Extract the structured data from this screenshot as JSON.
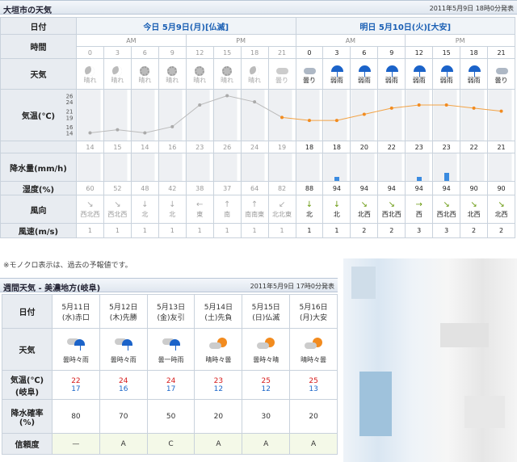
{
  "header1": {
    "title": "大垣市の天気",
    "published": "2011年5月9日 18時0分発表"
  },
  "labels": {
    "date": "日付",
    "time": "時間",
    "weather": "天気",
    "temp": "気温(℃)",
    "precip": "降水量(mm/h)",
    "humidity": "湿度(%)",
    "wind_dir": "風向",
    "wind_speed": "風速(m/s)"
  },
  "days": [
    "今日 5月9日(月)[仏滅]",
    "明日 5月10日(火)[大安]"
  ],
  "ampm": [
    "AM",
    "PM",
    "AM",
    "PM"
  ],
  "hours": [
    "0",
    "3",
    "6",
    "9",
    "12",
    "15",
    "18",
    "21",
    "0",
    "3",
    "6",
    "9",
    "12",
    "15",
    "18",
    "21"
  ],
  "weather": [
    "晴れ",
    "晴れ",
    "晴れ",
    "晴れ",
    "晴れ",
    "晴れ",
    "晴れ",
    "曇り",
    "曇り",
    "弱雨",
    "弱雨",
    "弱雨",
    "弱雨",
    "弱雨",
    "弱雨",
    "曇り"
  ],
  "weather_icons": [
    "moon",
    "moon",
    "sun",
    "sun",
    "sun",
    "sun",
    "moon",
    "cloud",
    "cloud",
    "umbrella",
    "umbrella",
    "umbrella",
    "umbrella",
    "umbrella",
    "umbrella",
    "cloud"
  ],
  "y_ticks": [
    "26",
    "24",
    "21",
    "19",
    "16",
    "14"
  ],
  "temps": [
    "14",
    "15",
    "14",
    "16",
    "23",
    "26",
    "24",
    "19",
    "18",
    "18",
    "20",
    "22",
    "23",
    "23",
    "22",
    "21"
  ],
  "precip": [
    "0",
    "0",
    "0",
    "0",
    "0",
    "0",
    "0",
    "0",
    "0",
    "1",
    "0",
    "0",
    "1",
    "2",
    "0",
    "0"
  ],
  "humidity": [
    "60",
    "52",
    "48",
    "42",
    "38",
    "37",
    "64",
    "82",
    "88",
    "94",
    "94",
    "94",
    "94",
    "94",
    "90",
    "90"
  ],
  "wind_dir": [
    "西北西",
    "西北西",
    "北",
    "北",
    "東",
    "南",
    "南南東",
    "北北東",
    "北",
    "北",
    "北西",
    "西北西",
    "西",
    "西北西",
    "北西",
    "北西"
  ],
  "wind_arrows": [
    "↘",
    "↘",
    "↓",
    "↓",
    "←",
    "↑",
    "↑",
    "↙",
    "↓",
    "↓",
    "↘",
    "↘",
    "→",
    "↘",
    "↘",
    "↘"
  ],
  "wind_speed": [
    "1",
    "1",
    "1",
    "1",
    "1",
    "1",
    "1",
    "1",
    "1",
    "1",
    "2",
    "2",
    "3",
    "3",
    "2",
    "2"
  ],
  "note": "※モノクロ表示は、過去の予報値です。",
  "header2": {
    "title": "週間天気 - 美濃地方(岐阜)",
    "published": "2011年5月9日 17時0分発表"
  },
  "week_labels": {
    "date": "日付",
    "weather": "天気",
    "temp1": "気温(℃)",
    "temp2": "(岐阜)",
    "rain1": "降水確率",
    "rain2": "(%)",
    "rel": "信頼度"
  },
  "week": [
    {
      "date": "5月11日",
      "wd": "(水)",
      "rk": "赤口",
      "wx": "曇時々雨",
      "hi": "22",
      "lo": "17",
      "rain": "80",
      "rel": "—"
    },
    {
      "date": "5月12日",
      "wd": "(木)",
      "rk": "先勝",
      "wx": "曇時々雨",
      "hi": "24",
      "lo": "16",
      "rain": "70",
      "rel": "A"
    },
    {
      "date": "5月13日",
      "wd": "(金)",
      "rk": "友引",
      "wx": "曇一時雨",
      "hi": "24",
      "lo": "17",
      "rain": "50",
      "rel": "C"
    },
    {
      "date": "5月14日",
      "wd": "(土)",
      "rk": "先負",
      "wx": "晴時々曇",
      "hi": "23",
      "lo": "12",
      "rain": "20",
      "rel": "A"
    },
    {
      "date": "5月15日",
      "wd": "(日)",
      "rk": "仏滅",
      "wx": "曇時々晴",
      "hi": "25",
      "lo": "12",
      "rain": "30",
      "rel": "A"
    },
    {
      "date": "5月16日",
      "wd": "(月)",
      "rk": "大安",
      "wx": "晴時々曇",
      "hi": "25",
      "lo": "13",
      "rain": "20",
      "rel": "A"
    }
  ]
}
